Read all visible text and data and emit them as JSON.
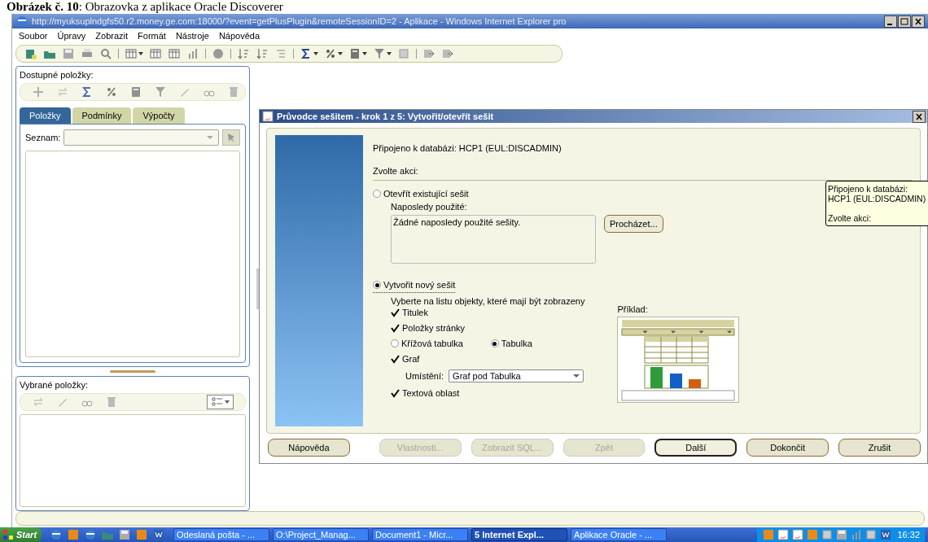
{
  "caption": "**Obrázek č. 10**: Obrazovka z aplikace Oracle Discoverer",
  "browser": {
    "title": "http://myuksuplndgfs50.r2.money.ge.com:18000/?event=getPlusPlugin&remoteSessionID=2 - Aplikace - Windows Internet Explorer pro",
    "menu": [
      "Soubor",
      "Úpravy",
      "Zobrazit",
      "Formát",
      "Nástroje",
      "Nápověda"
    ]
  },
  "left_panel": {
    "available_label": "Dostupné položky:",
    "tabs": [
      {
        "label": "Položky",
        "selected": true
      },
      {
        "label": "Podmínky",
        "selected": false
      },
      {
        "label": "Výpočty",
        "selected": false
      }
    ],
    "list_label": "Seznam:",
    "selected_label": "Vybrané položky:"
  },
  "dialog": {
    "title": "Průvodce sešitem - krok 1 z 5: Vytvořit/otevřít sešit",
    "connection": "Připojeno k databázi: HCP1 (EUL:DISCADMIN)",
    "action_label": "Zvolte akci:",
    "open_option": {
      "label": "Otevřít existující sešit",
      "selected": false
    },
    "recent_label": "Naposledy použité:",
    "recent_empty": "Žádné naposledy použité sešity.",
    "browse_button": "Procházet...",
    "new_option": {
      "label": "Vytvořit nový sešit",
      "selected": true
    },
    "objects_hint": "Vyberte na listu objekty, které mají být zobrazeny",
    "objects": [
      {
        "kind": "checkbox",
        "label": "Titulek",
        "checked": true
      },
      {
        "kind": "checkbox",
        "label": "Položky stránky",
        "checked": true
      },
      {
        "kind": "radios",
        "options": [
          {
            "label": "Křížová tabulka",
            "selected": false
          },
          {
            "label": "Tabulka",
            "selected": true
          }
        ]
      },
      {
        "kind": "checkbox",
        "label": "Graf",
        "checked": true
      },
      {
        "kind": "select",
        "label": "Umístění:",
        "value": "Graf pod Tabulka"
      },
      {
        "kind": "checkbox",
        "label": "Textová oblast",
        "checked": true
      }
    ],
    "example_label": "Příklad:",
    "buttons": [
      {
        "label": "Nápověda",
        "disabled": false,
        "default": false
      },
      {
        "label": "Vlastnosti...",
        "disabled": true,
        "default": false
      },
      {
        "label": "Zobrazit SQL...",
        "disabled": true,
        "default": false
      },
      {
        "label": "Zpět",
        "disabled": true,
        "default": false
      },
      {
        "label": "Další",
        "disabled": false,
        "default": true
      },
      {
        "label": "Dokončit",
        "disabled": false,
        "default": false
      },
      {
        "label": "Zrušit",
        "disabled": false,
        "default": false
      }
    ]
  },
  "tooltip": [
    "Připojeno k databázi:",
    "HCP1 (EUL:DISCADMIN)",
    "Zvolte akci:"
  ],
  "taskbar": {
    "start": "Start",
    "tasks": [
      {
        "label": "Odeslaná pošta - ...",
        "selected": false
      },
      {
        "label": "O:\\Project_Manag...",
        "selected": false
      },
      {
        "label": "Document1 - Micr...",
        "selected": false
      },
      {
        "label": "5 Internet Expl...",
        "selected": true
      },
      {
        "label": "Aplikace Oracle - ...",
        "selected": false
      }
    ],
    "clock": "16:32"
  }
}
